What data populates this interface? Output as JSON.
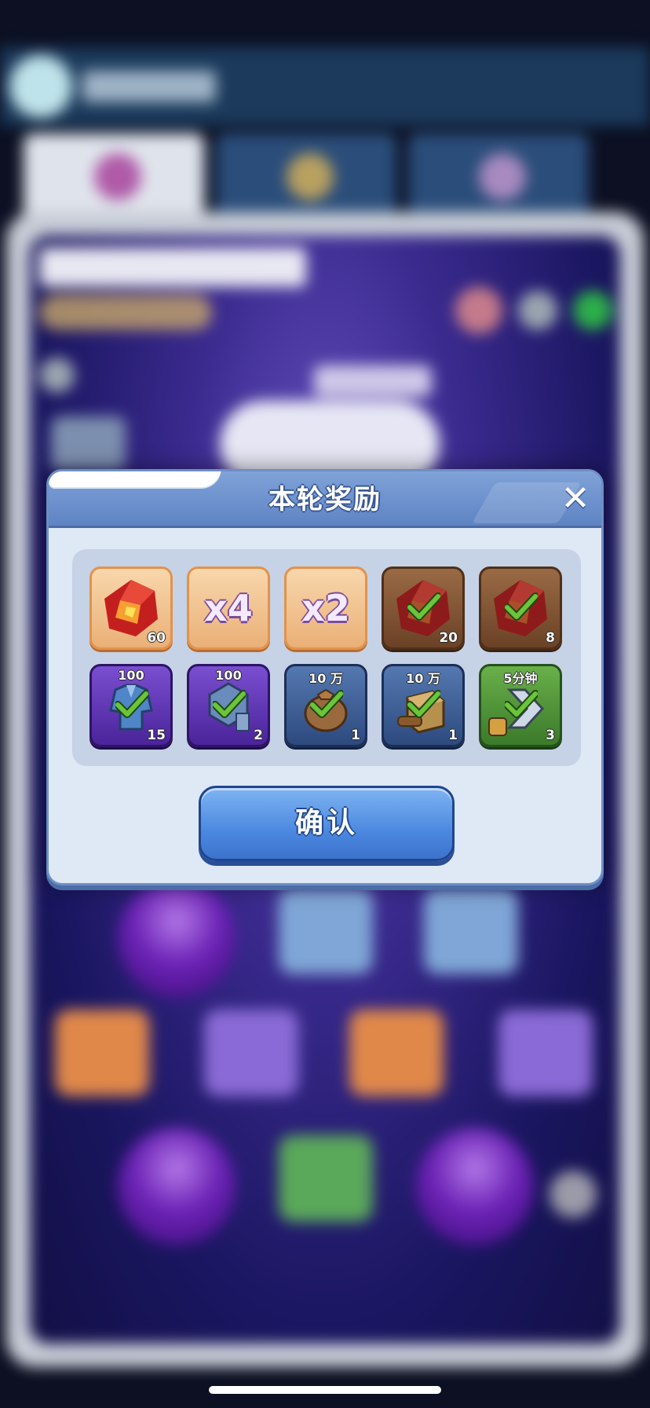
{
  "dialog": {
    "title": "本轮奖励",
    "close_label": "✕",
    "confirm_label": "确认"
  },
  "rewards": [
    {
      "name": "red-crystal",
      "tier": "orange",
      "count": "60",
      "top": "",
      "claimed": false
    },
    {
      "name": "multiplier",
      "tier": "orange",
      "text": "x4",
      "count": "",
      "top": "",
      "claimed": false
    },
    {
      "name": "multiplier",
      "tier": "orange",
      "text": "x2",
      "count": "",
      "top": "",
      "claimed": false
    },
    {
      "name": "red-crystal",
      "tier": "brown",
      "count": "20",
      "top": "",
      "claimed": true
    },
    {
      "name": "red-crystal",
      "tier": "brown",
      "count": "8",
      "top": "",
      "claimed": true
    },
    {
      "name": "blue-armor",
      "tier": "purple",
      "count": "15",
      "top": "100",
      "claimed": true
    },
    {
      "name": "blue-nut",
      "tier": "purple",
      "count": "2",
      "top": "100",
      "claimed": true
    },
    {
      "name": "coin-bag",
      "tier": "blue",
      "count": "1",
      "top": "10 万",
      "claimed": true
    },
    {
      "name": "wood-crate",
      "tier": "blue",
      "count": "1",
      "top": "10 万",
      "claimed": true
    },
    {
      "name": "speedup",
      "tier": "green",
      "count": "3",
      "top": "5分钟",
      "claimed": true
    }
  ],
  "colors": {
    "header": "#5f84c4",
    "panel": "#dfe8f5",
    "check": "#6cc43a",
    "confirm": "#4c89e0"
  }
}
